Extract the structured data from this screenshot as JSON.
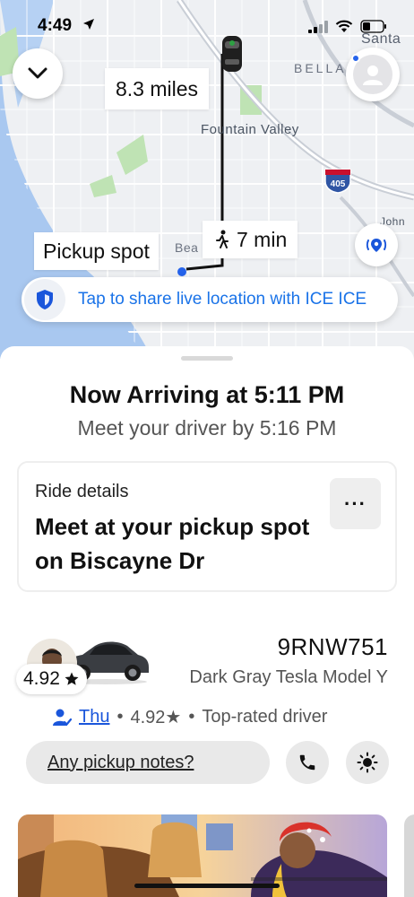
{
  "status_bar": {
    "time": "4:49"
  },
  "map": {
    "labels": {
      "santa": "Santa A",
      "bella": "BELLA",
      "fountain_valley": "Fountain Valley",
      "john": "John W",
      "seal": "Bea"
    },
    "highway_shield": "405",
    "distance": "8.3 miles",
    "walk_time": "7 min",
    "pickup_label": "Pickup spot",
    "share_banner": "Tap to share live location with ICE ICE"
  },
  "trip": {
    "arriving_title": "Now Arriving at 5:11 PM",
    "meet_by": "Meet your driver by 5:16 PM",
    "ride_details_label": "Ride details",
    "ride_details_text": "Meet at your pickup spot on Biscayne Dr",
    "more_label": "···"
  },
  "driver": {
    "rating_pill": "4.92",
    "plate": "9RNW751",
    "car_model": "Dark Gray Tesla Model Y",
    "name": "Thu",
    "rating_line": "4.92★",
    "badge": "Top-rated driver",
    "separator": "•"
  },
  "actions": {
    "notes": "Any pickup notes?"
  },
  "colors": {
    "accent_blue": "#1a73e8",
    "route": "#111111",
    "map_water": "#a9c8f0",
    "map_park": "#bfe3b4"
  }
}
